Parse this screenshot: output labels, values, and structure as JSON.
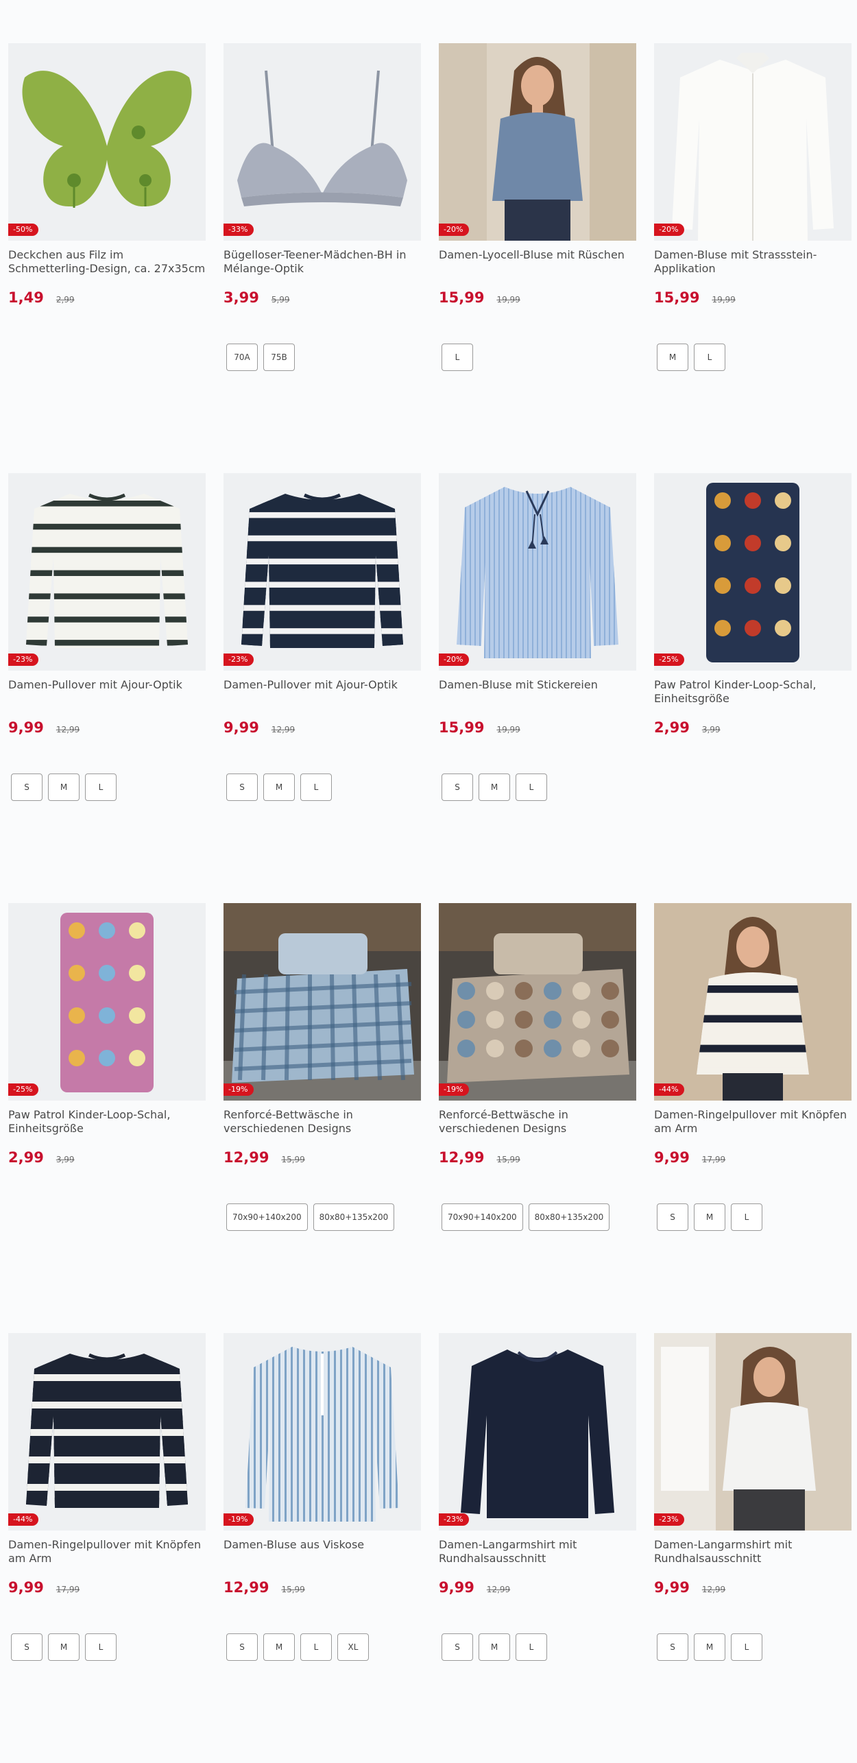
{
  "colors": {
    "price": "#c8102e",
    "badge": "#d6141e",
    "background": "#fafbfc"
  },
  "products": [
    {
      "title": "Deckchen aus Filz im Schmetterling-Design, ca. 27x35cm",
      "discount": "-50%",
      "price": "1,49",
      "old_price": "2,99",
      "sizes": [],
      "image": "green-felt-butterfly"
    },
    {
      "title": "Bügelloser-Teener-Mädchen-BH in Mélange-Optik",
      "discount": "-33%",
      "price": "3,99",
      "old_price": "5,99",
      "sizes": [
        "70A",
        "75B"
      ],
      "image": "grey-bra"
    },
    {
      "title": "Damen-Lyocell-Bluse mit Rüschen",
      "discount": "-20%",
      "price": "15,99",
      "old_price": "19,99",
      "sizes": [
        "L"
      ],
      "image": "model-denim-blouse"
    },
    {
      "title": "Damen-Bluse mit Strassstein-Applikation",
      "discount": "-20%",
      "price": "15,99",
      "old_price": "19,99",
      "sizes": [
        "M",
        "L"
      ],
      "image": "white-blouse"
    },
    {
      "title": "Damen-Pullover mit Ajour-Optik",
      "discount": "-23%",
      "price": "9,99",
      "old_price": "12,99",
      "sizes": [
        "S",
        "M",
        "L"
      ],
      "image": "white-striped-sweater"
    },
    {
      "title": "Damen-Pullover mit Ajour-Optik",
      "discount": "-23%",
      "price": "9,99",
      "old_price": "12,99",
      "sizes": [
        "S",
        "M",
        "L"
      ],
      "image": "navy-striped-sweater"
    },
    {
      "title": "Damen-Bluse mit Stickereien",
      "discount": "-20%",
      "price": "15,99",
      "old_price": "19,99",
      "sizes": [
        "S",
        "M",
        "L"
      ],
      "image": "blue-striped-blouse-tassel"
    },
    {
      "title": "Paw Patrol Kinder-Loop-Schal, Einheitsgröße",
      "discount": "-25%",
      "price": "2,99",
      "old_price": "3,99",
      "sizes": [],
      "image": "navy-loop-scarf"
    },
    {
      "title": "Paw Patrol Kinder-Loop-Schal, Einheitsgröße",
      "discount": "-25%",
      "price": "2,99",
      "old_price": "3,99",
      "sizes": [],
      "image": "pink-loop-scarf"
    },
    {
      "title": "Renforcé-Bettwäsche in verschiedenen Designs",
      "discount": "-19%",
      "price": "12,99",
      "old_price": "15,99",
      "sizes": [
        "70x90+140x200",
        "80x80+135x200"
      ],
      "image": "blue-check-bedding"
    },
    {
      "title": "Renforcé-Bettwäsche in verschiedenen Designs",
      "discount": "-19%",
      "price": "12,99",
      "old_price": "15,99",
      "sizes": [
        "70x90+140x200",
        "80x80+135x200"
      ],
      "image": "floral-bedding"
    },
    {
      "title": "Damen-Ringelpullover mit Knöpfen am Arm",
      "discount": "-44%",
      "price": "9,99",
      "old_price": "17,99",
      "sizes": [
        "S",
        "M",
        "L"
      ],
      "image": "model-striped-sweater"
    },
    {
      "title": "Damen-Ringelpullover mit Knöpfen am Arm",
      "discount": "-44%",
      "price": "9,99",
      "old_price": "17,99",
      "sizes": [
        "S",
        "M",
        "L"
      ],
      "image": "navy-ringel-sweater"
    },
    {
      "title": "Damen-Bluse aus Viskose",
      "discount": "-19%",
      "price": "12,99",
      "old_price": "15,99",
      "sizes": [
        "S",
        "M",
        "L",
        "XL"
      ],
      "image": "blue-viscose-blouse"
    },
    {
      "title": "Damen-Langarmshirt mit Rundhalsausschnitt",
      "discount": "-23%",
      "price": "9,99",
      "old_price": "12,99",
      "sizes": [
        "S",
        "M",
        "L"
      ],
      "image": "navy-longsleeve"
    },
    {
      "title": "Damen-Langarmshirt mit Rundhalsausschnitt",
      "discount": "-23%",
      "price": "9,99",
      "old_price": "12,99",
      "sizes": [
        "S",
        "M",
        "L"
      ],
      "image": "model-white-longsleeve"
    }
  ]
}
